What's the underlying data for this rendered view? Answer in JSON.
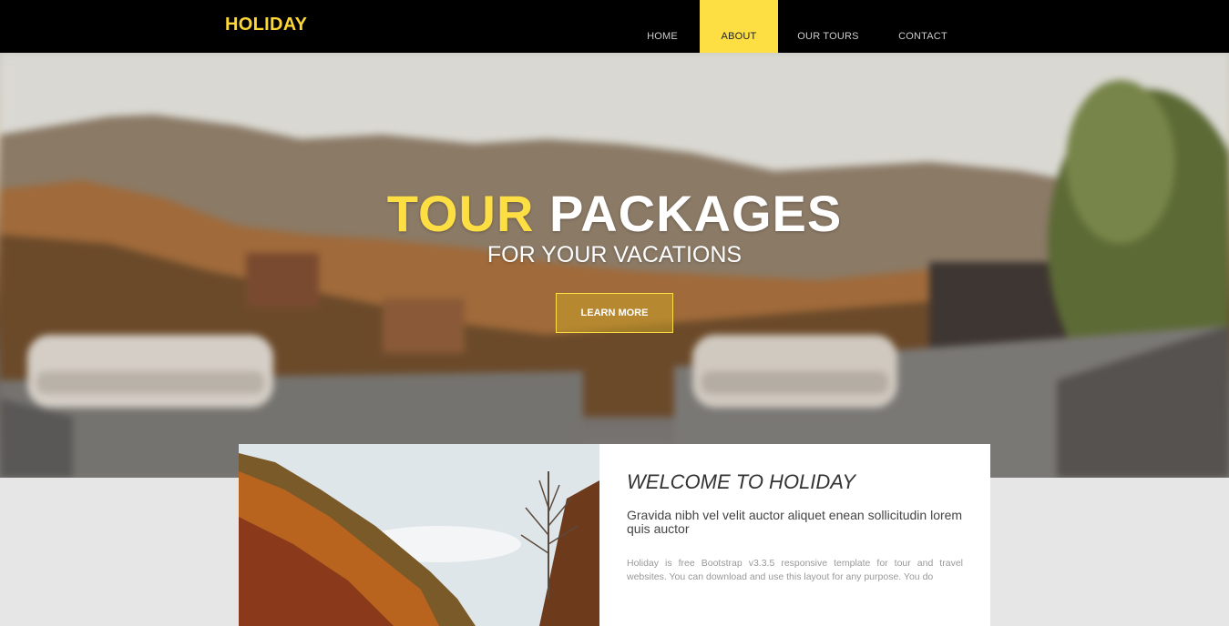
{
  "brand": "HOLIDAY",
  "nav": [
    {
      "label": "HOME",
      "active": false
    },
    {
      "label": "ABOUT",
      "active": true
    },
    {
      "label": "OUR TOURS",
      "active": false
    },
    {
      "label": "CONTACT",
      "active": false
    }
  ],
  "hero": {
    "title_accent": "TOUR",
    "title_rest": "PACKAGES",
    "subtitle": "FOR YOUR VACATIONS",
    "button": "LEARN MORE"
  },
  "welcome": {
    "title": "WELCOME TO HOLIDAY",
    "lead": "Gravida nibh vel velit auctor aliquet enean sollicitudin lorem quis auctor",
    "body": "Holiday is free Bootstrap v3.3.5 responsive template for tour and travel websites. You can download and use this layout for any purpose. You do"
  },
  "colors": {
    "accent": "#fddf43",
    "nav_bg": "#000000",
    "section_bg": "#e6e6e6"
  }
}
